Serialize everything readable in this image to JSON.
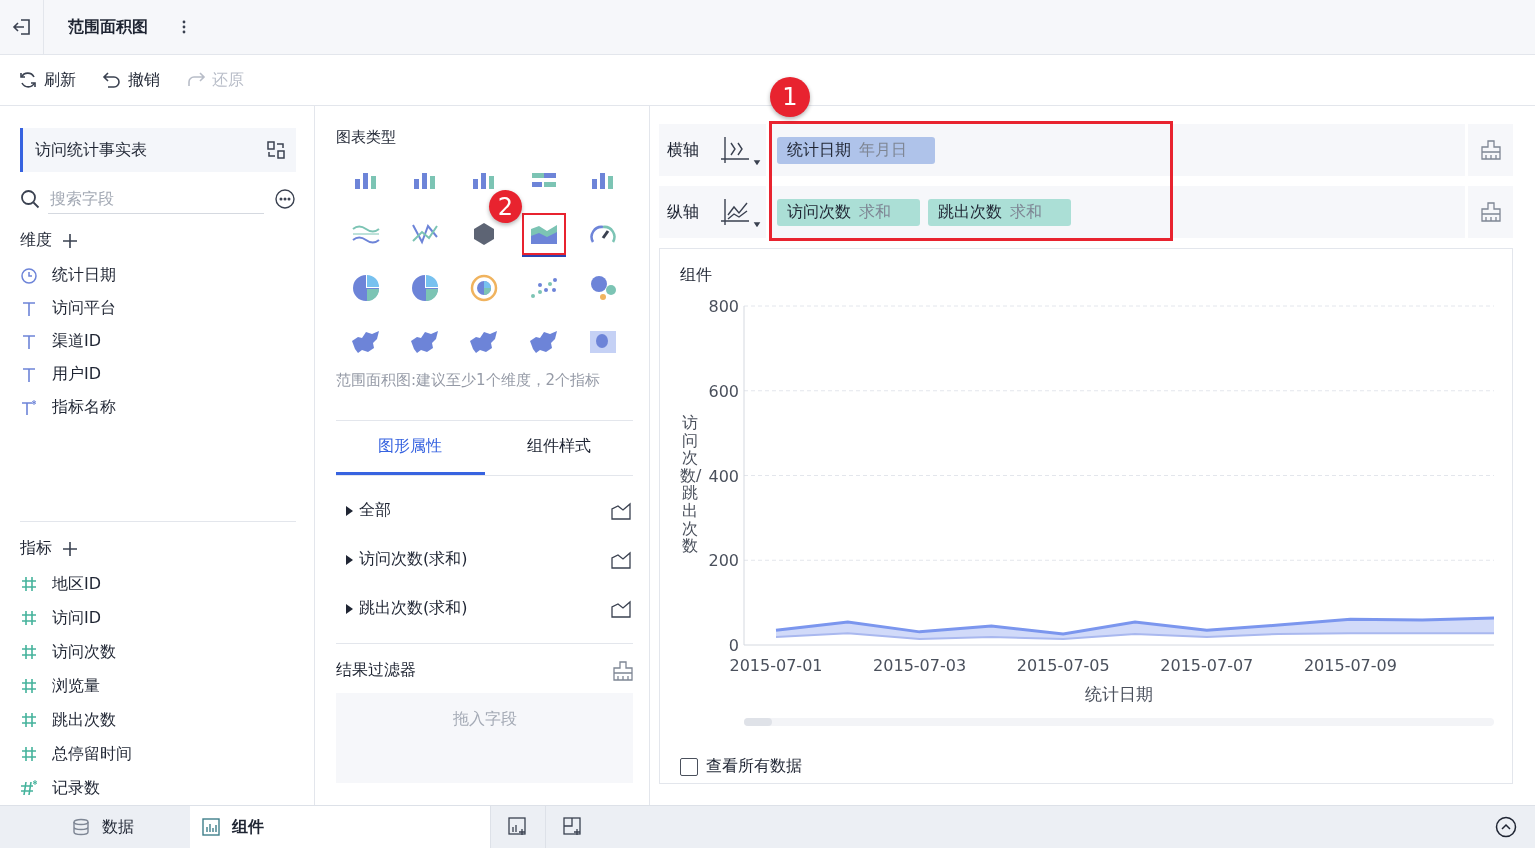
{
  "header": {
    "title": "范围面积图"
  },
  "toolbar": [
    {
      "label": "刷新",
      "kind": "refresh",
      "disabled": false
    },
    {
      "label": "撤销",
      "kind": "undo",
      "disabled": false
    },
    {
      "label": "还原",
      "kind": "redo",
      "disabled": true
    }
  ],
  "data_panel": {
    "table": "访问统计事实表",
    "search": {
      "placeholder": "搜索字段"
    },
    "dimensions": {
      "title": "维度",
      "fields": [
        {
          "label": "统计日期",
          "kind": "date"
        },
        {
          "label": "访问平台",
          "kind": "text"
        },
        {
          "label": "渠道ID",
          "kind": "text"
        },
        {
          "label": "用户ID",
          "kind": "text"
        },
        {
          "label": "指标名称",
          "kind": "text-calc"
        }
      ]
    },
    "measures": {
      "title": "指标",
      "fields": [
        {
          "label": "地区ID",
          "kind": "number"
        },
        {
          "label": "访问ID",
          "kind": "number"
        },
        {
          "label": "访问次数",
          "kind": "number"
        },
        {
          "label": "浏览量",
          "kind": "number"
        },
        {
          "label": "跳出次数",
          "kind": "number"
        },
        {
          "label": "总停留时间",
          "kind": "number"
        },
        {
          "label": "记录数",
          "kind": "number-calc"
        }
      ]
    }
  },
  "chart_types": {
    "title": "图表类型",
    "items": [
      {
        "kind": "bar",
        "selected": false
      },
      {
        "kind": "bar",
        "selected": false
      },
      {
        "kind": "bar",
        "selected": false
      },
      {
        "kind": "hbar",
        "selected": false
      },
      {
        "kind": "bar",
        "selected": false
      },
      {
        "kind": "wave",
        "selected": false
      },
      {
        "kind": "line",
        "selected": false
      },
      {
        "kind": "radar",
        "selected": false
      },
      {
        "kind": "area",
        "selected": true
      },
      {
        "kind": "gauge",
        "selected": false
      },
      {
        "kind": "pie",
        "selected": false
      },
      {
        "kind": "pie",
        "selected": false
      },
      {
        "kind": "ring",
        "selected": false
      },
      {
        "kind": "scatter",
        "selected": false
      },
      {
        "kind": "bubble",
        "selected": false
      },
      {
        "kind": "map",
        "selected": false
      },
      {
        "kind": "map",
        "selected": false
      },
      {
        "kind": "map",
        "selected": false
      },
      {
        "kind": "map",
        "selected": false
      },
      {
        "kind": "heat",
        "selected": false
      }
    ],
    "hint": "范围面积图:建议至少1个维度，2个指标"
  },
  "property_tabs": [
    {
      "label": "图形属性",
      "selected": true
    },
    {
      "label": "组件样式",
      "selected": false
    }
  ],
  "property_rows": [
    "全部",
    "访问次数(求和)",
    "跳出次数(求和)"
  ],
  "result_filter": {
    "title": "结果过滤器",
    "placeholder": "拖入字段"
  },
  "axes": [
    {
      "label": "横轴",
      "pills": [
        {
          "name": "统计日期",
          "agg": "年月日",
          "kind": "dimension"
        }
      ]
    },
    {
      "label": "纵轴",
      "pills": [
        {
          "name": "访问次数",
          "agg": "求和",
          "kind": "measure"
        },
        {
          "name": "跳出次数",
          "agg": "求和",
          "kind": "measure"
        }
      ]
    }
  ],
  "widget": {
    "title": "组件",
    "chart_data": {
      "type": "area",
      "xlabel": "统计日期",
      "ylabel": "访问次数/跳出次数",
      "categories": [
        "2015-07-01",
        null,
        "2015-07-03",
        null,
        "2015-07-05",
        null,
        "2015-07-07",
        null,
        "2015-07-09",
        null,
        null
      ],
      "grid": true,
      "ylim": [
        0,
        800
      ],
      "yticks": [
        0,
        200,
        400,
        600,
        800
      ],
      "series": [
        {
          "type": "area",
          "color": "#7b96ee",
          "values": [
            35,
            54,
            31,
            45,
            26,
            54,
            35,
            47,
            61,
            59,
            64
          ]
        },
        {
          "type": "line",
          "color": "#a9b8ef",
          "values": [
            19,
            28,
            14,
            19,
            14,
            26,
            19,
            26,
            28,
            28,
            28
          ]
        }
      ]
    },
    "show_all": {
      "label": "查看所有数据",
      "checked": false
    }
  },
  "bottom_tabs": [
    {
      "label": "数据",
      "kind": "data",
      "selected": false
    },
    {
      "label": "组件",
      "kind": "widget",
      "selected": true
    }
  ],
  "annotations": [
    {
      "label": "1"
    },
    {
      "label": "2"
    }
  ]
}
